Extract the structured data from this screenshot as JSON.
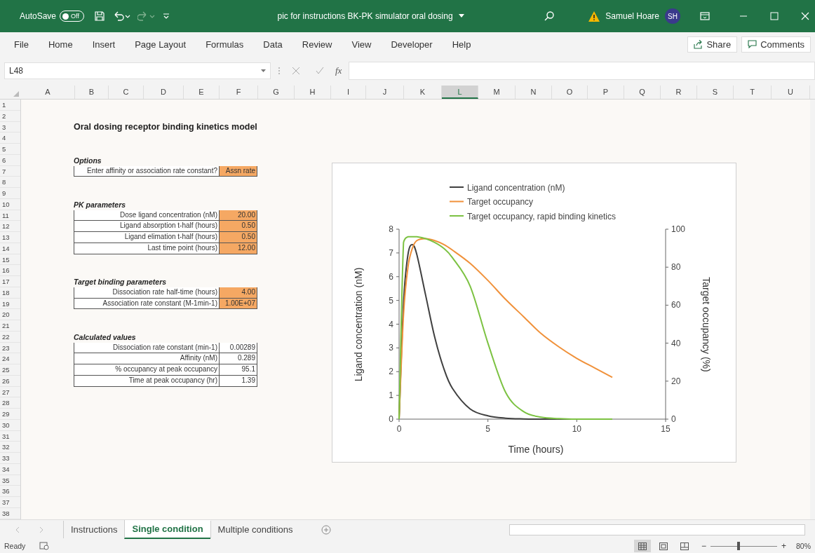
{
  "title_bar": {
    "autosave": {
      "label": "AutoSave",
      "state_text": "Off",
      "on": false
    },
    "title": "pic for instructions BK-PK simulator oral dosing",
    "user": "Samuel Hoare",
    "initials": "SH"
  },
  "ribbon": {
    "tabs": [
      "File",
      "Home",
      "Insert",
      "Page Layout",
      "Formulas",
      "Data",
      "Review",
      "View",
      "Developer",
      "Help"
    ],
    "share": "Share",
    "comments": "Comments"
  },
  "formula_bar": {
    "name_box": "L48",
    "fx": "fx"
  },
  "columns": [
    {
      "label": "A",
      "selected": false
    },
    {
      "label": "B",
      "selected": false
    },
    {
      "label": "C",
      "selected": false
    },
    {
      "label": "D",
      "selected": false
    },
    {
      "label": "E",
      "selected": false
    },
    {
      "label": "F",
      "selected": false
    },
    {
      "label": "G",
      "selected": false
    },
    {
      "label": "H",
      "selected": false
    },
    {
      "label": "I",
      "selected": false
    },
    {
      "label": "J",
      "selected": false
    },
    {
      "label": "K",
      "selected": false
    },
    {
      "label": "L",
      "selected": true
    },
    {
      "label": "M",
      "selected": false
    },
    {
      "label": "N",
      "selected": false
    },
    {
      "label": "O",
      "selected": false
    },
    {
      "label": "P",
      "selected": false
    },
    {
      "label": "Q",
      "selected": false
    },
    {
      "label": "R",
      "selected": false
    },
    {
      "label": "S",
      "selected": false
    },
    {
      "label": "T",
      "selected": false
    },
    {
      "label": "U",
      "selected": false
    }
  ],
  "row_numbers": [
    "1",
    "2",
    "3",
    "4",
    "5",
    "6",
    "7",
    "8",
    "9",
    "10",
    "11",
    "12",
    "13",
    "14",
    "15",
    "16",
    "17",
    "18",
    "19",
    "20",
    "21",
    "22",
    "23",
    "24",
    "25",
    "26",
    "27",
    "28",
    "29",
    "30",
    "31",
    "32",
    "33",
    "34",
    "35",
    "36",
    "37",
    "38"
  ],
  "sheet": {
    "title": "Oral dosing receptor binding kinetics model",
    "sections": [
      {
        "heading": "Options",
        "rows": [
          {
            "label": "Enter affinity or association rate constant?",
            "value": "Assn rate",
            "kind": "input"
          }
        ]
      },
      {
        "heading": "PK parameters",
        "rows": [
          {
            "label": "Dose ligand concentration (nM)",
            "value": "20.00",
            "kind": "input"
          },
          {
            "label": "Ligand absorption t-half (hours)",
            "value": "0.50",
            "kind": "input"
          },
          {
            "label": "Ligand elimation t-half (hours)",
            "value": "0.50",
            "kind": "input"
          },
          {
            "label": "Last time point (hours)",
            "value": "12.00",
            "kind": "input"
          }
        ]
      },
      {
        "heading": "Target binding parameters",
        "rows": [
          {
            "label": "Dissociation rate half-time (hours)",
            "value": "4.00",
            "kind": "input"
          },
          {
            "label": "Association rate constant (M-1min-1)",
            "value": "1.00E+07",
            "kind": "input"
          }
        ]
      },
      {
        "heading": "Calculated values",
        "rows": [
          {
            "label": "Dissociation rate constant (min-1)",
            "value": "0.00289",
            "kind": "output"
          },
          {
            "label": "Affinity (nM)",
            "value": "0.289",
            "kind": "output"
          },
          {
            "label": "% occupancy at peak occupancy",
            "value": "95.1",
            "kind": "output"
          },
          {
            "label": "Time at peak occupancy (hr)",
            "value": "1.39",
            "kind": "output"
          }
        ]
      }
    ]
  },
  "chart": {
    "chart_data": {
      "type": "line",
      "xlabel": "Time (hours)",
      "ylabel": "Ligand concentration (nM)",
      "xlim": [
        0,
        15
      ],
      "ylim": [
        0,
        8
      ],
      "xticks": [
        0,
        5,
        10,
        15
      ],
      "yticks": [
        0,
        1,
        2,
        3,
        4,
        5,
        6,
        7,
        8
      ],
      "x": [
        0,
        0.25,
        0.5,
        0.75,
        1,
        1.5,
        2,
        2.5,
        3,
        4,
        5,
        6,
        7,
        8,
        9,
        10,
        11,
        12
      ],
      "series": [
        {
          "name": "Ligand concentration (nM)",
          "color": "#404040",
          "axis": "y",
          "values": [
            0,
            4.9,
            6.93,
            7.35,
            6.93,
            5.2,
            3.47,
            2.17,
            1.3,
            0.43,
            0.14,
            0.04,
            0.01,
            0,
            0,
            0,
            0,
            0
          ]
        },
        {
          "name": "Target occupancy",
          "color": "#f0913a",
          "axis": "y2",
          "values": [
            0,
            55,
            80,
            90,
            94,
            95,
            94,
            92,
            89,
            82,
            73,
            63,
            54,
            45,
            38,
            32,
            27,
            22
          ]
        },
        {
          "name": "Target occupancy, rapid binding kinetics",
          "color": "#7cc242",
          "axis": "y2",
          "values": [
            0,
            93,
            96,
            96,
            96,
            95,
            93,
            90,
            85,
            70,
            40,
            14,
            4,
            1,
            0.3,
            0,
            0,
            0
          ]
        }
      ],
      "legend": "top",
      "y2label": "Target occupancy (%)",
      "y2lim": [
        0,
        100
      ],
      "y2ticks": [
        0,
        20,
        40,
        60,
        80,
        100
      ]
    }
  },
  "sheet_tabs": [
    {
      "label": "Instructions",
      "selected": false
    },
    {
      "label": "Single condition",
      "selected": true
    },
    {
      "label": "Multiple conditions",
      "selected": false
    }
  ],
  "status_bar": {
    "status": "Ready",
    "views": [
      {
        "kind": "normal",
        "selected": true
      },
      {
        "kind": "page-layout",
        "selected": false
      },
      {
        "kind": "page-break",
        "selected": false
      }
    ],
    "zoom": {
      "level": 0.42,
      "reading": "80%",
      "minus": "−",
      "plus": "+"
    }
  }
}
